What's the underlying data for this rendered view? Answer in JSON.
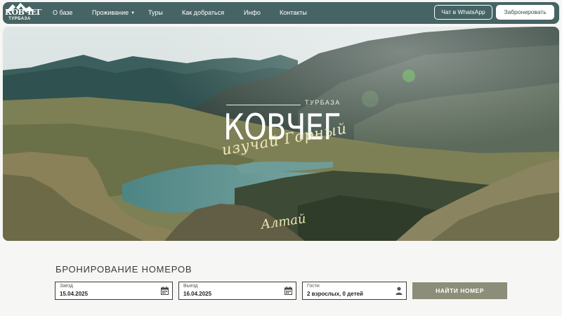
{
  "brand": {
    "logo_text": "КОВЧЕГ",
    "logo_subtext": "ТУРБАЗА"
  },
  "nav": {
    "items": [
      {
        "label": "О базе"
      },
      {
        "label": "Проживание",
        "has_dropdown": true
      },
      {
        "label": "Туры"
      },
      {
        "label": "Как добраться"
      },
      {
        "label": "Инфо"
      },
      {
        "label": "Контакты"
      }
    ],
    "whatsapp_label": "Чат в WhatsApp",
    "book_label": "Забронировать"
  },
  "hero": {
    "kicker": "ТУРБАЗА",
    "title": "КОВЧЕГ",
    "script_line": "изучай Горный",
    "script_bottom": "Алтай"
  },
  "booking": {
    "title": "БРОНИРОВАНИЕ НОМЕРОВ",
    "checkin": {
      "label": "Заезд",
      "value": "15.04.2025",
      "icon": "calendar-icon"
    },
    "checkout": {
      "label": "Выезд",
      "value": "16.04.2025",
      "icon": "calendar-icon"
    },
    "guests": {
      "label": "Гости",
      "value": "2 взрослых, 0 детей",
      "icon": "person-icon"
    },
    "submit_label": "НАЙТИ НОМЕР"
  },
  "colors": {
    "nav_bg": "#466463",
    "button_accent": "#8d8e79",
    "page_bg": "#f6f6f4"
  }
}
